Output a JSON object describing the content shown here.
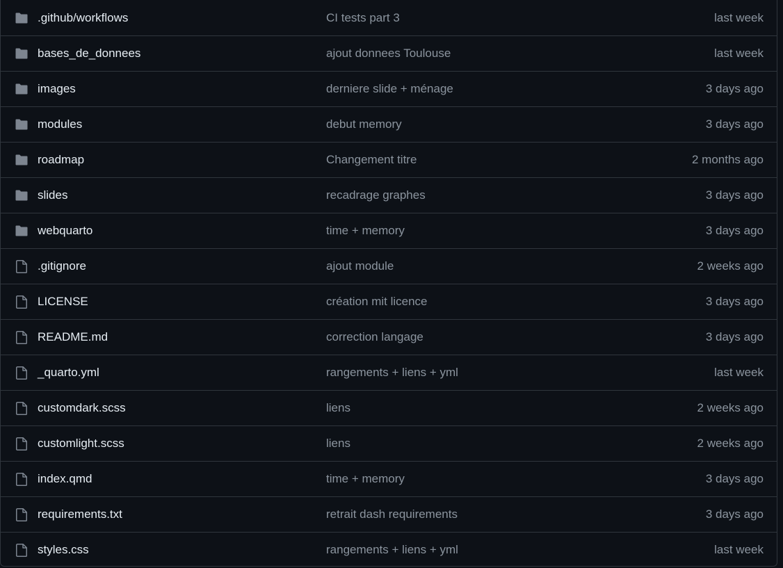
{
  "colors": {
    "background": "#0d1117",
    "border": "#30363d",
    "text_primary": "#e6edf3",
    "text_muted": "#8b949e",
    "folder_icon": "#7d8590"
  },
  "files": [
    {
      "type": "folder",
      "icon": "folder-icon",
      "name": ".github/workflows",
      "message": "CI tests part 3",
      "age": "last week"
    },
    {
      "type": "folder",
      "icon": "folder-icon",
      "name": "bases_de_donnees",
      "message": "ajout donnees Toulouse",
      "age": "last week"
    },
    {
      "type": "folder",
      "icon": "folder-icon",
      "name": "images",
      "message": "derniere slide + ménage",
      "age": "3 days ago"
    },
    {
      "type": "folder",
      "icon": "folder-icon",
      "name": "modules",
      "message": "debut memory",
      "age": "3 days ago"
    },
    {
      "type": "folder",
      "icon": "folder-icon",
      "name": "roadmap",
      "message": "Changement titre",
      "age": "2 months ago"
    },
    {
      "type": "folder",
      "icon": "folder-icon",
      "name": "slides",
      "message": "recadrage graphes",
      "age": "3 days ago"
    },
    {
      "type": "folder",
      "icon": "folder-icon",
      "name": "webquarto",
      "message": "time + memory",
      "age": "3 days ago"
    },
    {
      "type": "file",
      "icon": "file-icon",
      "name": ".gitignore",
      "message": "ajout module",
      "age": "2 weeks ago"
    },
    {
      "type": "file",
      "icon": "file-icon",
      "name": "LICENSE",
      "message": "création mit licence",
      "age": "3 days ago"
    },
    {
      "type": "file",
      "icon": "file-icon",
      "name": "README.md",
      "message": "correction langage",
      "age": "3 days ago"
    },
    {
      "type": "file",
      "icon": "file-icon",
      "name": "_quarto.yml",
      "message": "rangements + liens + yml",
      "age": "last week"
    },
    {
      "type": "file",
      "icon": "file-icon",
      "name": "customdark.scss",
      "message": "liens",
      "age": "2 weeks ago"
    },
    {
      "type": "file",
      "icon": "file-icon",
      "name": "customlight.scss",
      "message": "liens",
      "age": "2 weeks ago"
    },
    {
      "type": "file",
      "icon": "file-icon",
      "name": "index.qmd",
      "message": "time + memory",
      "age": "3 days ago"
    },
    {
      "type": "file",
      "icon": "file-icon",
      "name": "requirements.txt",
      "message": "retrait dash requirements",
      "age": "3 days ago"
    },
    {
      "type": "file",
      "icon": "file-icon",
      "name": "styles.css",
      "message": "rangements + liens + yml",
      "age": "last week"
    }
  ]
}
